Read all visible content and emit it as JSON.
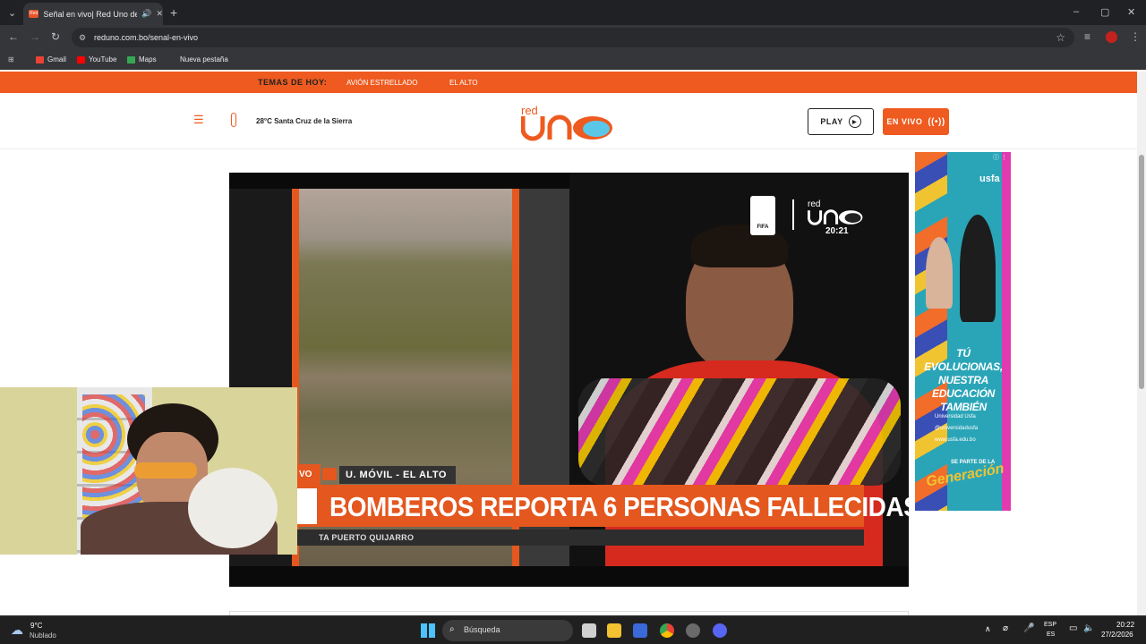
{
  "browser": {
    "tab_title": "Señal en vivo| Red Uno de",
    "favicon_text": "Red",
    "url": "reduno.com.bo/senal-en-vivo",
    "bookmarks": [
      "Gmail",
      "YouTube",
      "Maps",
      "Nueva pestaña"
    ]
  },
  "site": {
    "topics_label": "TEMAS DE HOY:",
    "topics": [
      "AVIÓN ESTRELLADO",
      "EL ALTO"
    ],
    "weather": "28°C Santa Cruz de la Sierra",
    "logo_red": "red",
    "play_label": "PLAY",
    "live_label": "EN VIVO",
    "accent": "#ee5a1f"
  },
  "video": {
    "fifa_label": "FIFA",
    "channel_red": "red",
    "clock": "20:21",
    "location_tag": "U. MÓVIL - EL ALTO",
    "headline": "BOMBEROS REPORTA 6 PERSONAS FALLECIDAS",
    "ticker": "TA PUERTO QUIJARRO",
    "live_badge": "VO"
  },
  "ad": {
    "brand": "usfa",
    "slogan": "TÚ EVOLUCIONAS, NUESTRA EDUCACIÓN TAMBIÉN",
    "social": [
      "Universidad Usfa",
      "@universidadusfa",
      "www.usfa.edu.bo"
    ],
    "footer_small": "SE PARTE DE LA",
    "footer_big": "Generación"
  },
  "taskbar": {
    "weather_temp": "9°C",
    "weather_desc": "Nublado",
    "search_placeholder": "Búsqueda",
    "lang_top": "ESP",
    "lang_bottom": "ES",
    "time": "20:22",
    "date": "27/2/2026"
  }
}
